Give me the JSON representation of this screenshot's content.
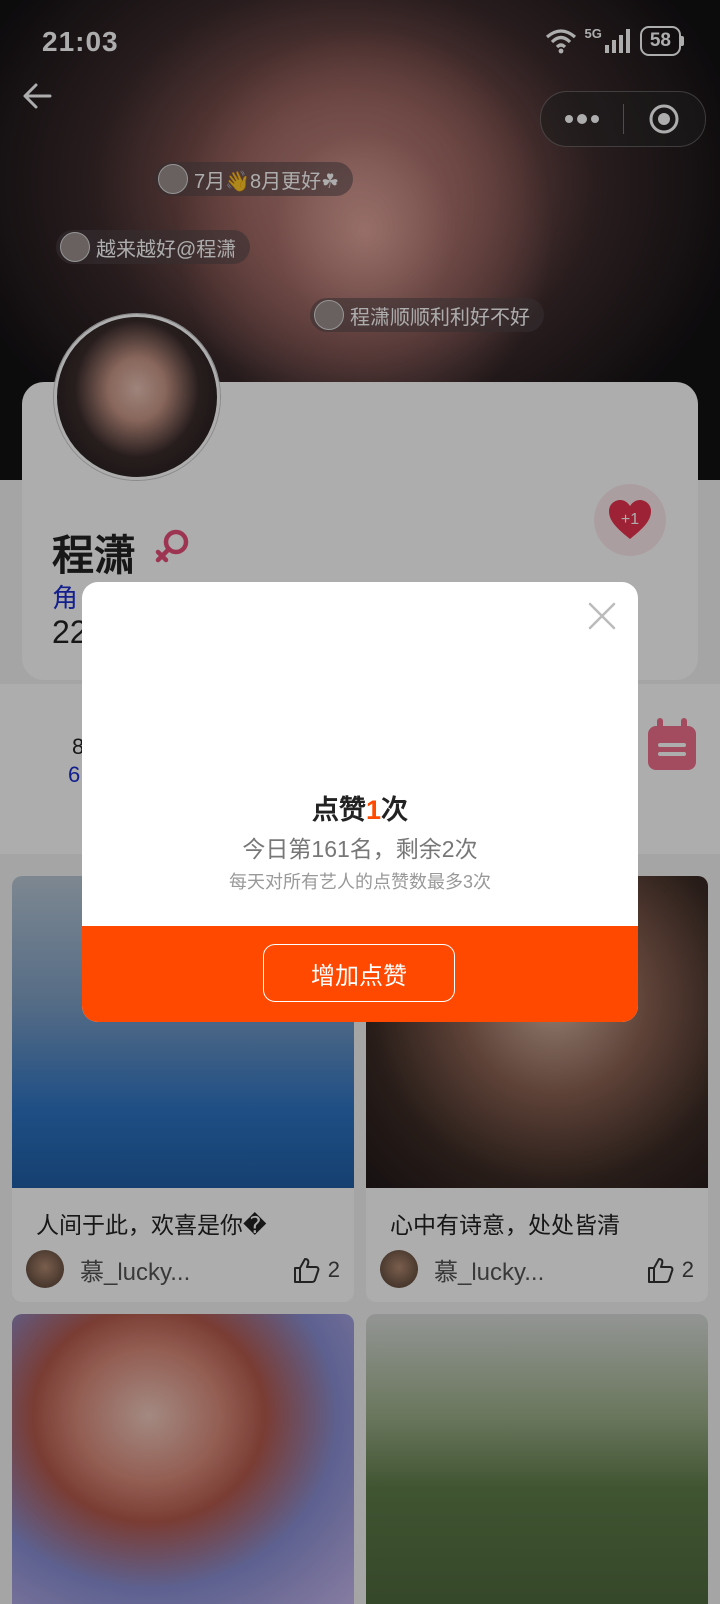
{
  "status_bar": {
    "time": "21:03",
    "network": "5G",
    "battery": "58"
  },
  "danmaku": [
    {
      "text": "7月👋8月更好☘"
    },
    {
      "text": "越来越好@程潇"
    },
    {
      "text": "程潇顺顺利利好不好"
    }
  ],
  "profile": {
    "name": "程潇",
    "role_partial": "角",
    "number_partial": "22",
    "like_badge": "+1"
  },
  "stats": {
    "line1": "8",
    "line2": "6"
  },
  "posts": [
    {
      "caption": "人间于此，欢喜是你�",
      "author": "慕_lucky...",
      "likes": "2"
    },
    {
      "caption": "心中有诗意，处处皆清",
      "author": "慕_lucky...",
      "likes": "2"
    }
  ],
  "modal": {
    "title_prefix": "点赞",
    "title_count": "1",
    "title_suffix": "次",
    "subtitle": "今日第161名，剩余2次",
    "note": "每天对所有艺人的点赞数最多3次",
    "button_label": "增加点赞"
  },
  "colors": {
    "accent": "#ff4800",
    "highlight": "#ff4a00",
    "link": "#1c2fd0",
    "heart": "#e8334f"
  }
}
